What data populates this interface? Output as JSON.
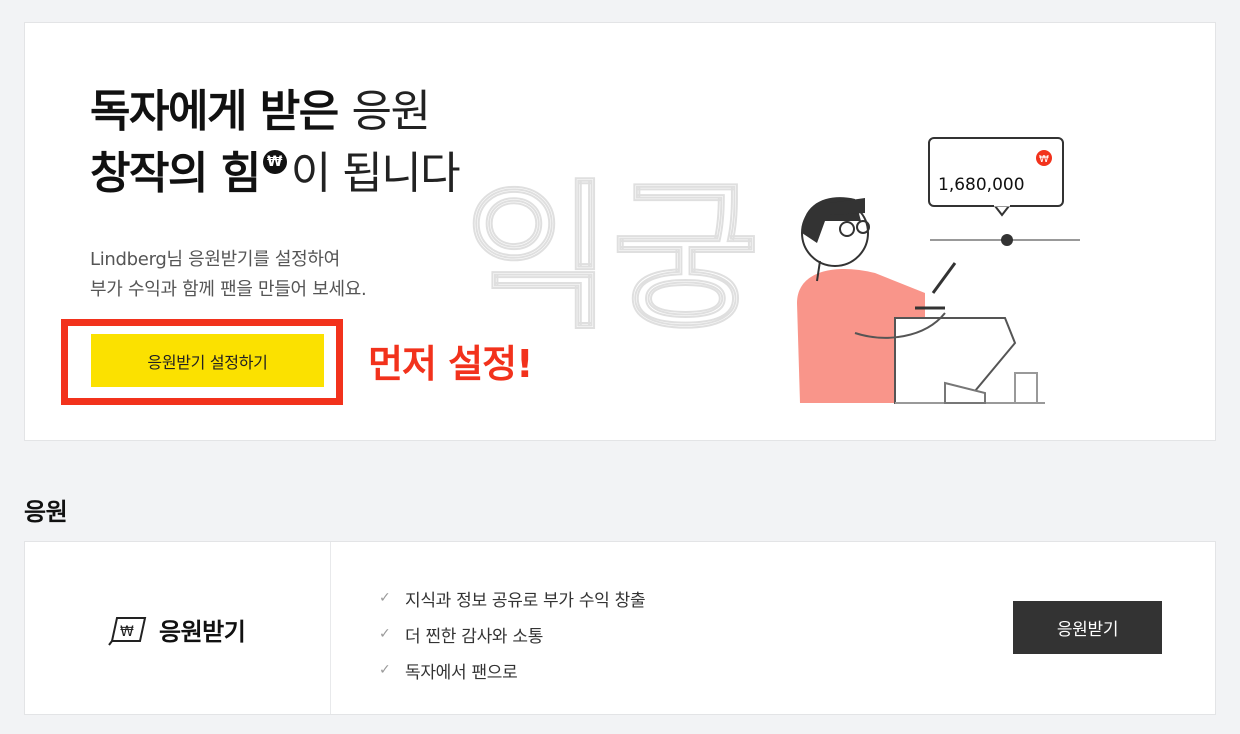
{
  "hero": {
    "title_line1_bold": "독자에게 받은",
    "title_line1_light": "응원",
    "title_line2_bold": "창작의 힘",
    "won_symbol": "₩",
    "title_line2_light": "이 됩니다",
    "desc_line1": "Lindberg님 응원받기를 설정하여",
    "desc_line2": "부가 수익과 함께 팬을 만들어 보세요.",
    "setup_button": "응원받기 설정하기",
    "annotation": "먼저 설정!",
    "amount": "1,680,000",
    "watermark": "익궁"
  },
  "section": {
    "title": "응원"
  },
  "card": {
    "logo_text": "응원받기",
    "features": [
      "지식과 정보 공유로 부가 수익 창출",
      "더 찐한 감사와 소통",
      "독자에서 팬으로"
    ],
    "button": "응원받기"
  },
  "colors": {
    "accent_yellow": "#fbe100",
    "annotation_red": "#f2321c",
    "illustration_salmon": "#f9958a",
    "dark_button": "#333333"
  }
}
